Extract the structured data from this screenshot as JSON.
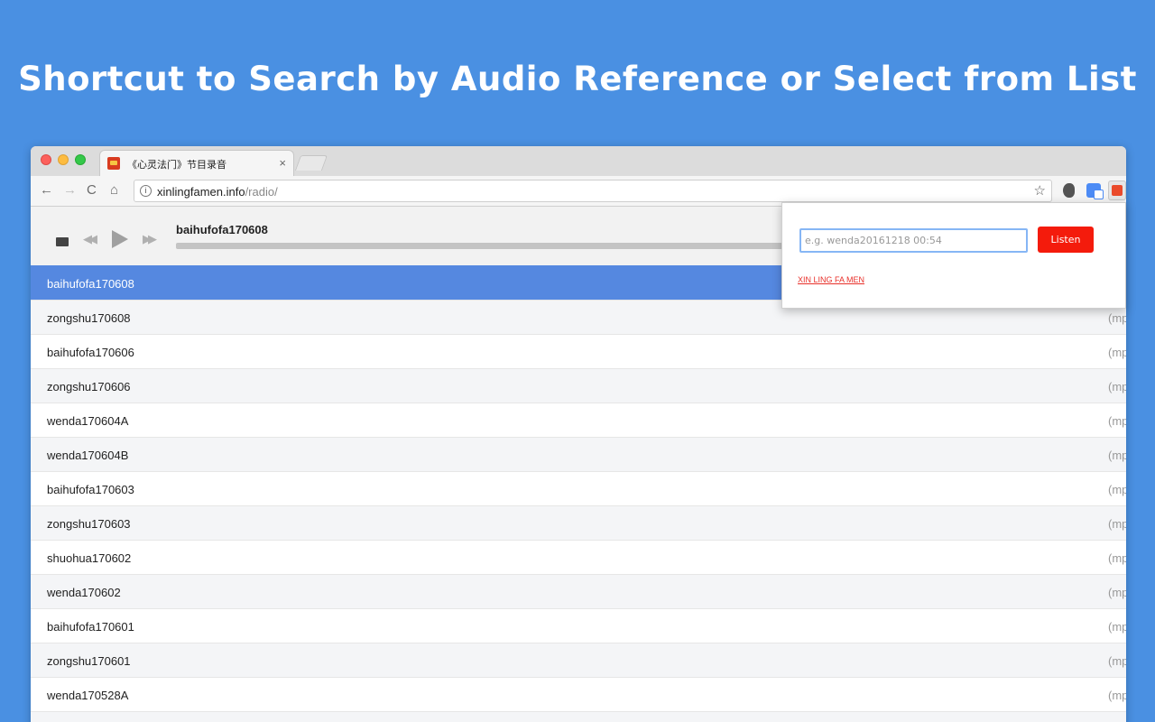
{
  "headline": "Shortcut to Search by Audio Reference or Select from List",
  "browser": {
    "tab": {
      "title": "《心灵法门》节目录音",
      "close_glyph": "×"
    },
    "toolbar": {
      "back_glyph": "←",
      "forward_glyph": "→",
      "reload_glyph": "C",
      "home_glyph": "⌂",
      "info_glyph": "i",
      "url_host": "xinlingfamen.info",
      "url_path": "/radio/",
      "star_glyph": "☆"
    },
    "extensions": [
      "evernote-icon",
      "google-translate-icon",
      "audio-search-extension-icon"
    ]
  },
  "player": {
    "now_playing": "baihufofa170608",
    "rewind_glyph": "◀◀",
    "forward_glyph": "▶▶",
    "progress": 0
  },
  "playlist": {
    "type_label": "(mp",
    "selected_index": 0,
    "items": [
      "baihufofa170608",
      "zongshu170608",
      "baihufofa170606",
      "zongshu170606",
      "wenda170604A",
      "wenda170604B",
      "baihufofa170603",
      "zongshu170603",
      "shuohua170602",
      "wenda170602",
      "baihufofa170601",
      "zongshu170601",
      "wenda170528A",
      ""
    ]
  },
  "popup": {
    "input_placeholder": "e.g. wenda20161218 00:54",
    "input_value": "",
    "listen_label": "Listen",
    "link_text": "XIN LING FA MEN"
  },
  "colors": {
    "background": "#4a90e2",
    "selected_row": "#5588e0",
    "listen_button": "#f41b0c",
    "link": "#e8302a"
  }
}
